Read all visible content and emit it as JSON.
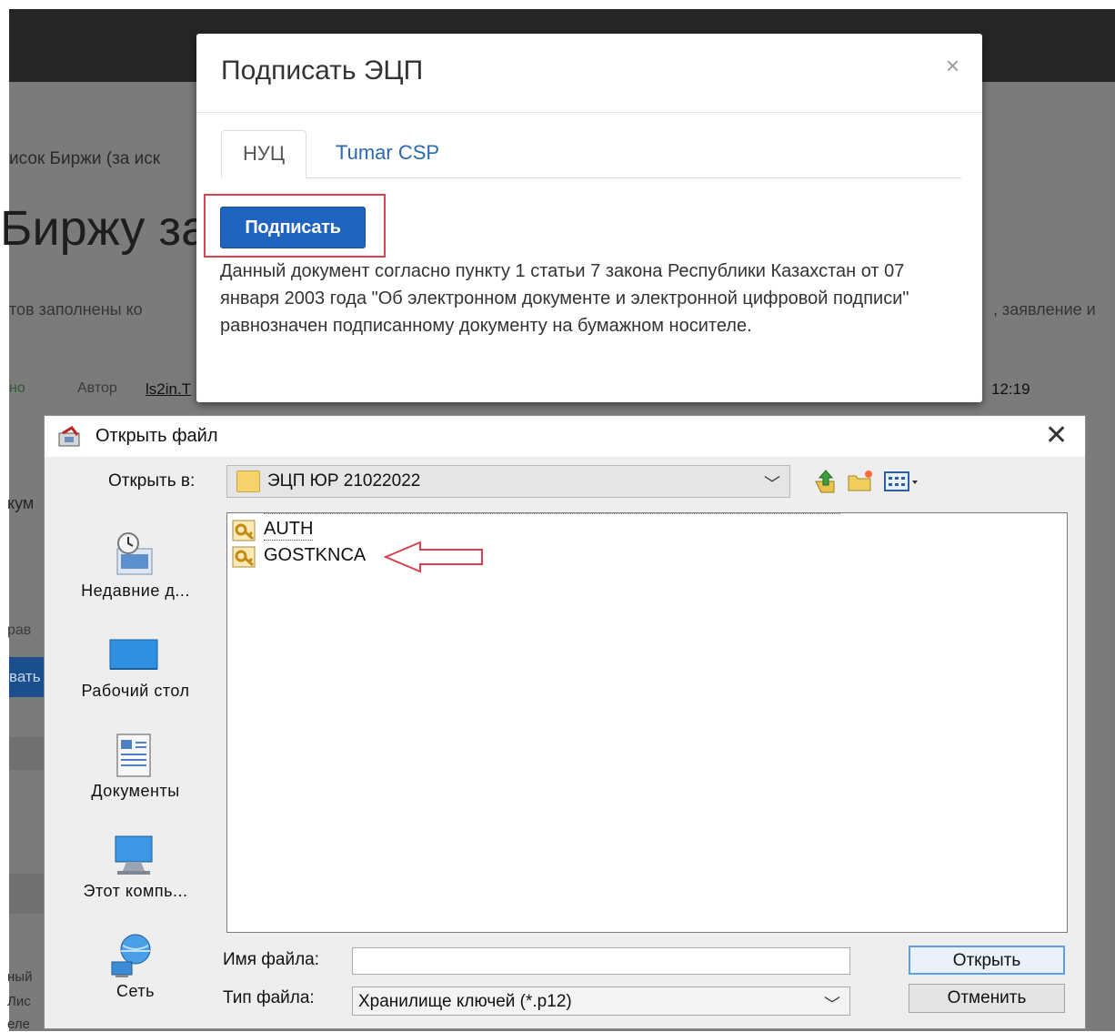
{
  "background": {
    "breadcrumb": "исок Биржи (за иск",
    "heading": "Биржу за",
    "line1_start": "тов заполнены ко",
    "line1_end": ", заявление и",
    "status": "но",
    "author_label": "Автор",
    "author_name": "ls2in.T",
    "time": "12:19",
    "left_text1": "кум",
    "left_text2": "рав",
    "left_button": "вать",
    "left_text3": "ный",
    "left_text4": "Лис",
    "left_text5": "еле"
  },
  "modal": {
    "title": "Подписать ЭЦП",
    "close_glyph": "×",
    "tabs": [
      {
        "label": "НУЦ",
        "active": true
      },
      {
        "label": "Tumar CSP",
        "active": false
      }
    ],
    "sign_button": "Подписать",
    "description": "Данный документ согласно пункту 1 статьи 7 закона Республики Казахстан от 07 января 2003 года \"Об электронном документе и электронной цифровой подписи\" равнозначен подписанному документу на бумажном носителе."
  },
  "dialog": {
    "title": "Открыть файл",
    "close_glyph": "✕",
    "look_in_label": "Открыть в:",
    "look_in_value": "ЭЦП ЮР 21022022",
    "places": [
      {
        "label": "Недавние д...",
        "icon": "recent-items-icon"
      },
      {
        "label": "Рабочий стол",
        "icon": "desktop-icon"
      },
      {
        "label": "Документы",
        "icon": "documents-icon"
      },
      {
        "label": "Этот компь...",
        "icon": "computer-icon"
      },
      {
        "label": "Сеть",
        "icon": "network-icon"
      }
    ],
    "files": [
      {
        "name": "AUTH",
        "icon": "key-file-icon"
      },
      {
        "name": "GOSTKNCA",
        "icon": "key-file-icon"
      }
    ],
    "file_name_label": "Имя файла:",
    "file_name_value": "",
    "file_type_label": "Тип файла:",
    "file_type_value": "Хранилище ключей (*.p12)",
    "open_button": "Открыть",
    "cancel_button": "Отменить"
  },
  "colors": {
    "primary_button": "#1f64c0",
    "highlight": "#d9414f",
    "tab_link": "#2a6ab0"
  }
}
